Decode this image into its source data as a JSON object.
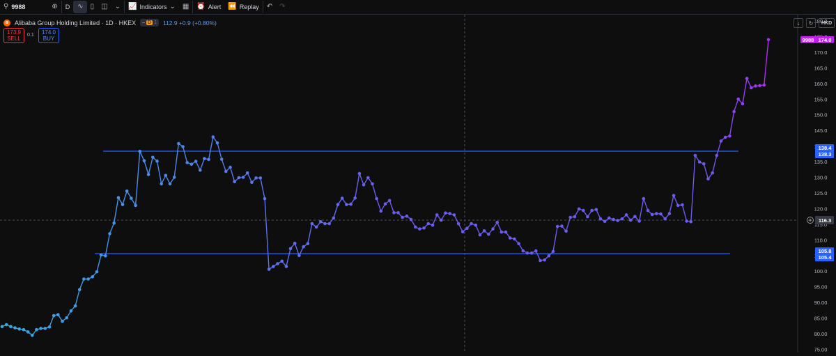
{
  "toolbar": {
    "symbol": "9988",
    "interval": "D",
    "indicators_label": "Indicators",
    "alert_label": "Alert",
    "replay_label": "Replay"
  },
  "legend": {
    "title": "Alibaba Group Holding Limited · 1D · HKEX",
    "badge": "D",
    "badge_count": "1",
    "quote": "112.9 +0.9 (+0.80%)",
    "sell_price": "173.9",
    "sell_label": "SELL",
    "spread": "0.1",
    "buy_price": "174.0",
    "buy_label": "BUY"
  },
  "price_scale": {
    "currency": "HKD",
    "ticks": [
      "180.0",
      "175.0",
      "170.0",
      "165.0",
      "160.0",
      "155.0",
      "150.0",
      "145.0",
      "140.0",
      "135.0",
      "130.0",
      "125.0",
      "120.0",
      "115.0",
      "110.0",
      "105.0",
      "100.0",
      "95.00",
      "90.00",
      "85.00",
      "80.00",
      "75.00"
    ],
    "ymin": 74,
    "ymax": 182
  },
  "labels": {
    "last_symbol": "9988",
    "last_price": "174.0",
    "upper_a": "138.4",
    "upper_b": "138.3",
    "crosshair": "116.3",
    "lower_a": "105.8",
    "lower_b": "105.4"
  },
  "colors": {
    "line_start": "#35a9e6",
    "line_mid": "#6b5cf0",
    "line_end": "#b02af0",
    "hline": "#2962ff",
    "label_blue": "#2962ff",
    "label_last": "#c41ef0"
  },
  "chart_data": {
    "type": "line",
    "title": "Alibaba Group Holding Limited · 1D · HKEX",
    "ylim": [
      74,
      182
    ],
    "grid": false,
    "series": [
      {
        "values": [
          82.3,
          82.9,
          82.3,
          81.9,
          81.5,
          81.3,
          80.6,
          79.5,
          81.3,
          81.7,
          81.7,
          82.2,
          85.8,
          86.1,
          84.0,
          85.1,
          87.3,
          88.9,
          94.1,
          97.5,
          97.5,
          98.2,
          99.8,
          105.2,
          104.9,
          112.0,
          115.4,
          123.5,
          121.3,
          125.6,
          123.3,
          121.0,
          138.3,
          135.3,
          130.9,
          136.4,
          135.2,
          127.9,
          130.6,
          127.9,
          130.0,
          140.8,
          139.8,
          134.7,
          134.2,
          135.1,
          132.3,
          136.0,
          135.7,
          142.9,
          141.0,
          135.8,
          131.9,
          133.2,
          128.6,
          129.9,
          130.0,
          131.4,
          128.4,
          129.8,
          129.8,
          123.2,
          100.6,
          101.5,
          102.4,
          103.2,
          101.5,
          107.2,
          108.9,
          105.0,
          107.8,
          108.8,
          115.2,
          114.1,
          115.8,
          115.2,
          115.2,
          117.0,
          121.3,
          123.3,
          121.3,
          121.4,
          123.4,
          131.2,
          127.6,
          129.9,
          127.9,
          123.2,
          119.2,
          121.5,
          122.6,
          118.7,
          118.7,
          117.2,
          117.6,
          116.5,
          114.1,
          113.5,
          113.8,
          115.2,
          114.7,
          118.0,
          116.3,
          118.6,
          118.4,
          118.0,
          115.2,
          112.6,
          113.7,
          115.2,
          114.7,
          111.6,
          112.9,
          111.8,
          113.5,
          115.6,
          112.5,
          112.5,
          110.6,
          110.3,
          108.8,
          106.5,
          105.8,
          105.8,
          106.5,
          103.4,
          103.6,
          104.9,
          106.3,
          114.3,
          114.4,
          112.8,
          117.2,
          117.4,
          119.9,
          119.4,
          117.4,
          119.4,
          119.7,
          116.7,
          115.9,
          117.0,
          116.5,
          116.2,
          116.7,
          118.0,
          116.3,
          117.5,
          116.0,
          123.2,
          119.4,
          118.1,
          118.4,
          118.3,
          116.7,
          118.4,
          124.2,
          121.0,
          121.2,
          116.0,
          115.8,
          137.0,
          134.9,
          134.3,
          129.5,
          131.4,
          137.0,
          141.6,
          142.8,
          143.2,
          151.0,
          155.0,
          153.5,
          161.6,
          158.6,
          159.2,
          159.3,
          159.5,
          174.0
        ]
      }
    ],
    "horizontal_lines": [
      138.35,
      105.6
    ]
  }
}
